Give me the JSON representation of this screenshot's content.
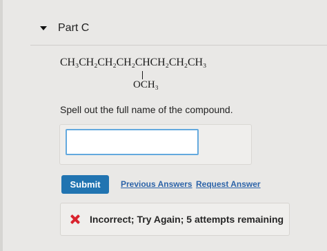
{
  "part": {
    "title": "Part C"
  },
  "formula": {
    "main_chain": "CH₃CH₂CH₂CH₂CHCH₂CH₂CH₃",
    "substituent": "OCH₃"
  },
  "question": {
    "prompt": "Spell out the full name of the compound."
  },
  "answer": {
    "value": "",
    "placeholder": ""
  },
  "actions": {
    "submit_label": "Submit",
    "previous_answers_label": "Previous Answers",
    "request_answer_label": "Request Answer"
  },
  "feedback": {
    "message": "Incorrect; Try Again; 5 attempts remaining",
    "icon": "incorrect-x-icon",
    "color": "#d9232e"
  },
  "colors": {
    "accent": "#2174b1",
    "link": "#2c63a8",
    "input_border": "#63a9de",
    "background": "#e9e8e6"
  }
}
